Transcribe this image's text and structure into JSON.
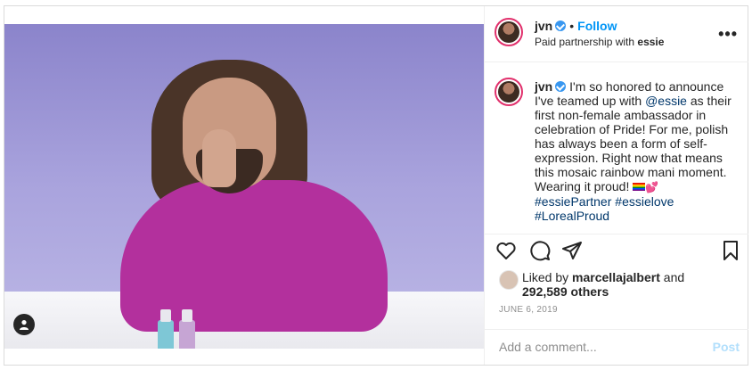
{
  "post": {
    "author": "jvn",
    "follow_label": "Follow",
    "dot": "•",
    "partnership_prefix": "Paid partnership with",
    "partner": "essie",
    "more_label": "•••"
  },
  "caption": {
    "username": "jvn",
    "text_before": "I'm so honored to announce I've teamed up with ",
    "mention": "@essie",
    "text_after": " as their first non-female ambassador in celebration of Pride! For me, polish has always been a form of self-expression. Right now that means this mosaic rainbow mani moment. Wearing it proud! ",
    "emoji": "💕",
    "hashtags": [
      "#essiePartner",
      "#essielove",
      "#LorealProud"
    ]
  },
  "likes": {
    "prefix": "Liked by",
    "user": "marcellajalbert",
    "conj": "and",
    "count_text": "292,589 others"
  },
  "date": "JUNE 6, 2019",
  "comment": {
    "placeholder": "Add a comment...",
    "post_label": "Post"
  },
  "icons": {
    "like": "heart-icon",
    "comment": "comment-icon",
    "share": "share-icon",
    "save": "bookmark-icon",
    "tagged_user": "user-icon"
  },
  "colors": {
    "link": "#0095f6",
    "verified": "#3897f0",
    "hashtag": "#00376b",
    "story_ring": "#e1306c",
    "post_disabled": "#b2dffc"
  }
}
